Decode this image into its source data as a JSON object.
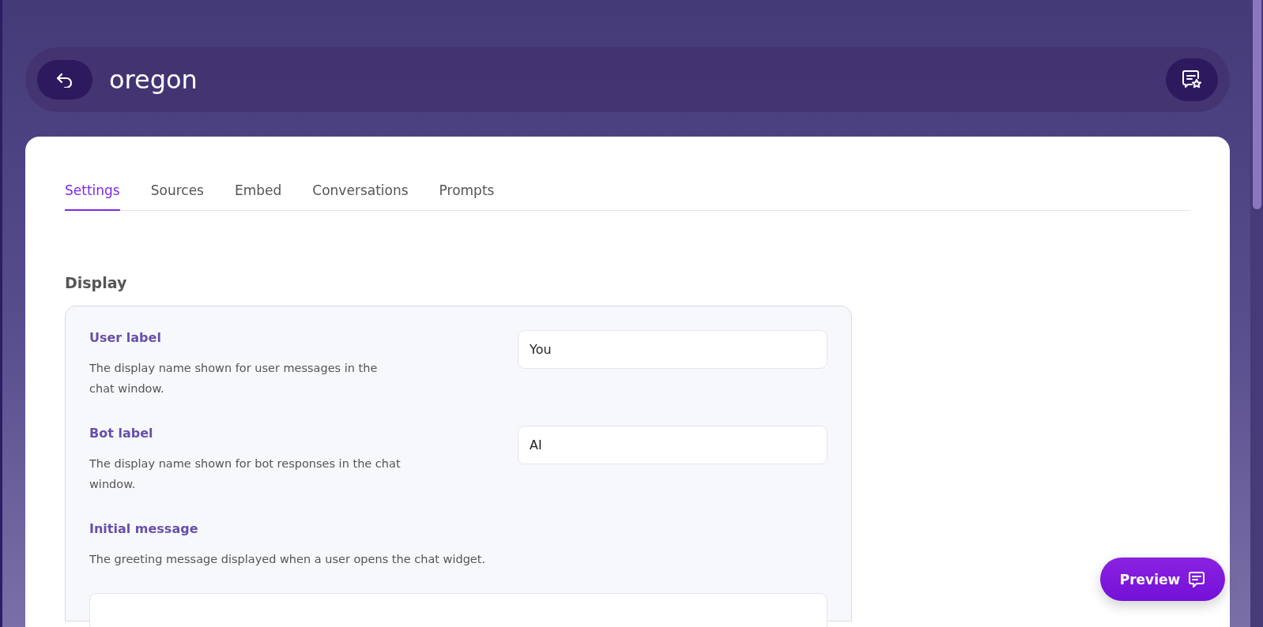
{
  "header": {
    "title": "oregon"
  },
  "tabs": [
    {
      "label": "Settings",
      "selected": true
    },
    {
      "label": "Sources",
      "selected": false
    },
    {
      "label": "Embed",
      "selected": false
    },
    {
      "label": "Conversations",
      "selected": false
    },
    {
      "label": "Prompts",
      "selected": false
    }
  ],
  "section": {
    "title": "Display",
    "fields": [
      {
        "kind": "inline",
        "label": "User label",
        "description": "The display name shown for user messages in the chat window.",
        "value": "You"
      },
      {
        "kind": "inline",
        "label": "Bot label",
        "description": "The display name shown for bot responses in the chat window.",
        "value": "AI"
      },
      {
        "kind": "stacked",
        "label": "Initial message",
        "description": "The greeting message displayed when a user opens the chat widget."
      }
    ]
  },
  "preview_button": {
    "label": "Preview"
  }
}
